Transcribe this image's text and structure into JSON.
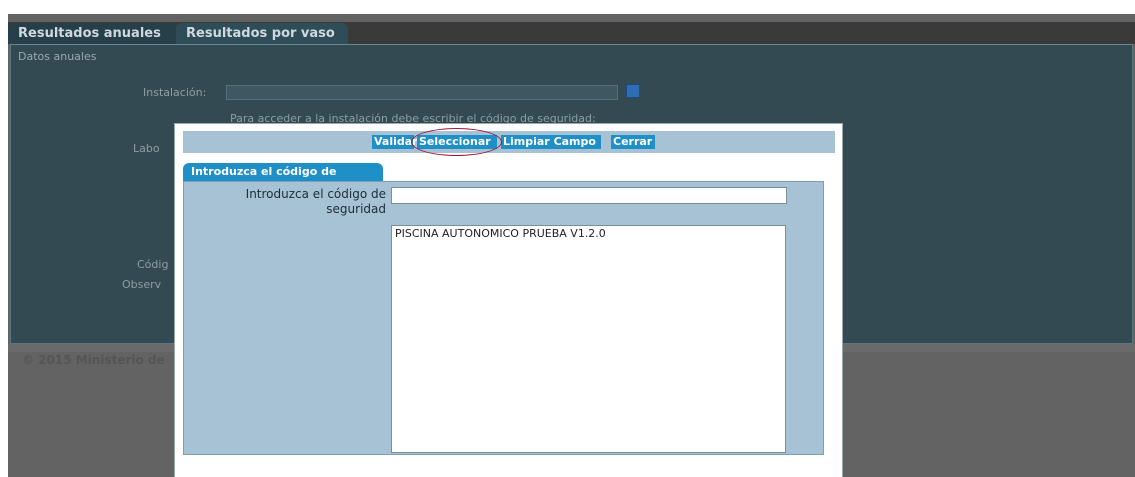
{
  "tabs": [
    {
      "label": "Resultados anuales"
    },
    {
      "label": "Resultados por vaso"
    }
  ],
  "background_form": {
    "legend": "Datos anuales",
    "installation_label": "Instalación:",
    "installation_hint": "Para acceder a la instalación debe escribir el código de seguridad:",
    "lab_label": "Labo",
    "code_label": "Códig",
    "obs_label": "Observ",
    "footer": "© 2015 Ministerio de"
  },
  "dialog": {
    "toolbar": {
      "validate": "Validar",
      "select": "Seleccionar",
      "clear": "Limpiar Campo",
      "close": "Cerrar"
    },
    "tab_label": "Introduzca el código de seguridad",
    "code_field": {
      "label": "Introduzca el código de seguridad",
      "value": ""
    },
    "results": [
      "PISCINA AUTONOMICO PRUEBA V1.2.0"
    ]
  },
  "colors": {
    "accent": "#1f8fc8",
    "highlight_ellipse": "#a0183a",
    "panel": "#a6c2d4"
  }
}
